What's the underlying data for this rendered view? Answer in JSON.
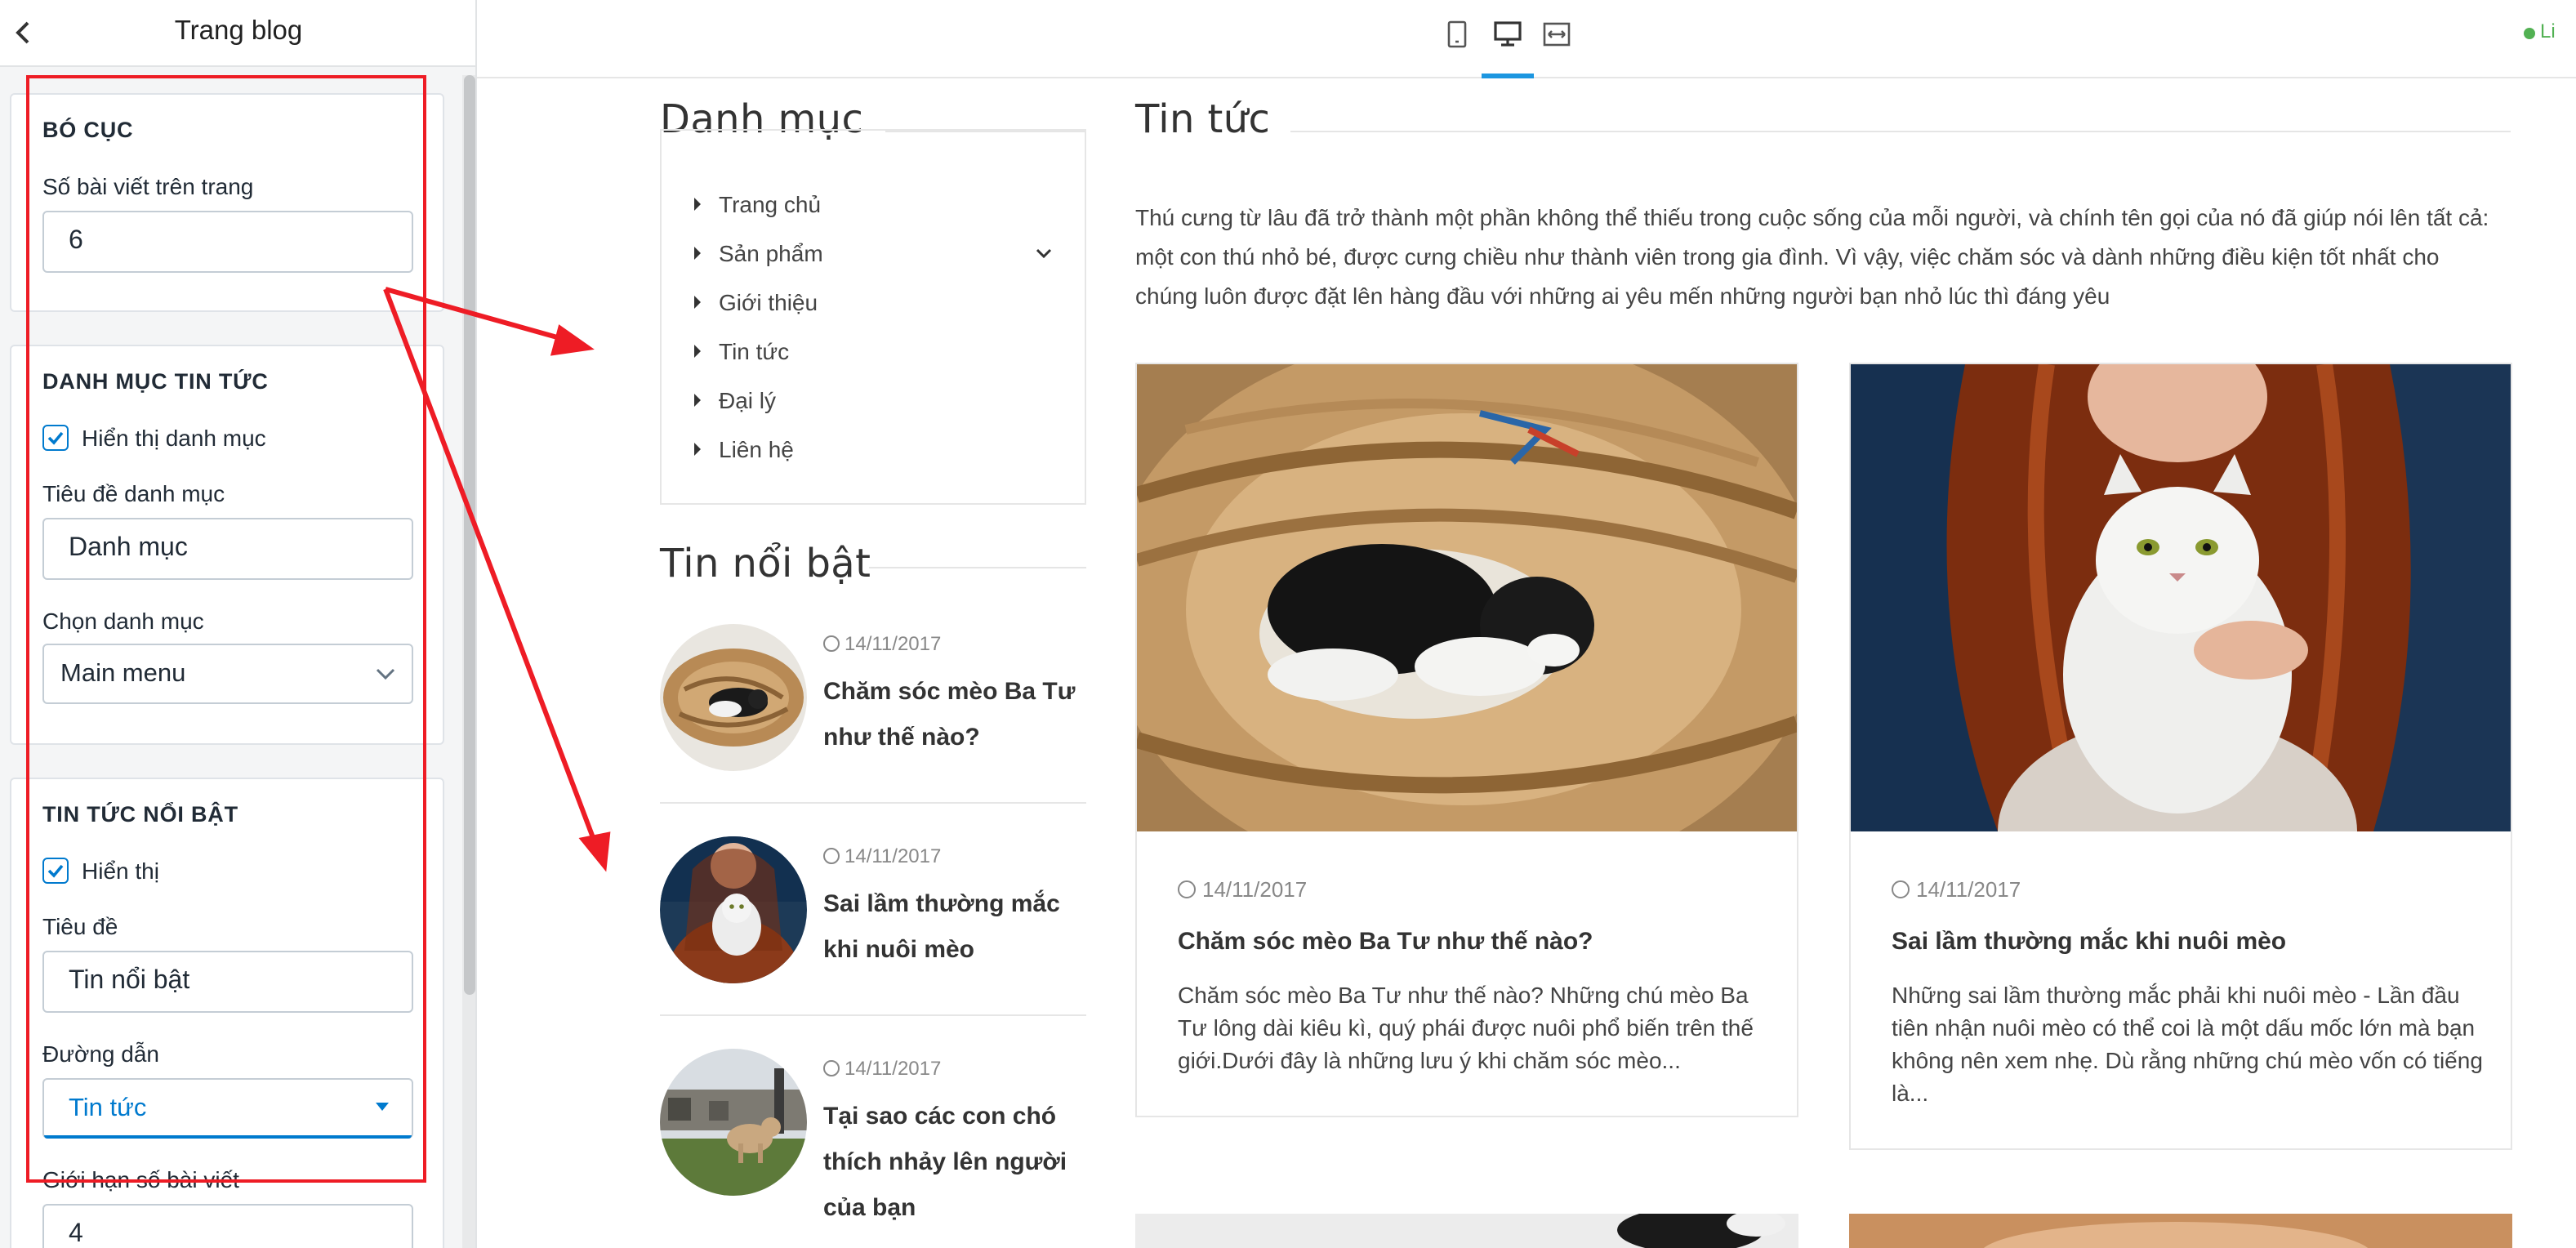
{
  "sidebar": {
    "title": "Trang blog",
    "back_icon": "chevron-left-icon",
    "layout": {
      "heading": "BÓ CỤC",
      "posts_per_page_label": "Số bài viết trên trang",
      "posts_per_page_value": "6"
    },
    "news_category": {
      "heading": "DANH MỤC TIN TỨC",
      "show_label": "Hiển thị danh mục",
      "show_checked": true,
      "title_label": "Tiêu đề danh mục",
      "title_value": "Danh mục",
      "choose_label": "Chọn danh mục",
      "choose_value": "Main menu"
    },
    "featured": {
      "heading": "TIN TỨC NỔI BẬT",
      "show_label": "Hiển thị",
      "show_checked": true,
      "title_label": "Tiêu đề",
      "title_value": "Tin nổi bật",
      "link_label": "Đường dẫn",
      "link_value": "Tin tức",
      "limit_label": "Giới hạn số bài viết",
      "limit_value": "4"
    }
  },
  "topbar": {
    "devices": [
      "mobile-icon",
      "desktop-icon",
      "fullwidth-icon"
    ],
    "active_device": "desktop-icon",
    "live_label": "Li",
    "accent_color": "#1c96e0"
  },
  "preview": {
    "categories": {
      "title": "Danh mục",
      "items": [
        "Trang chủ",
        "Sản phẩm",
        "Giới thiệu",
        "Tin tức",
        "Đại lý",
        "Liên hệ"
      ]
    },
    "featured": {
      "title": "Tin nổi bật",
      "posts": [
        {
          "date": "14/11/2017",
          "title": "Chăm sóc mèo Ba Tư như thế nào?"
        },
        {
          "date": "14/11/2017",
          "title": "Sai lầm thường mắc khi nuôi mèo"
        },
        {
          "date": "14/11/2017",
          "title": "Tại sao các con chó thích nhảy lên người của bạn"
        }
      ]
    },
    "news": {
      "title": "Tin tức",
      "intro": "Thú cưng từ lâu đã trở thành một phần không thể thiếu trong cuộc sống của mỗi người, và chính tên gọi của nó đã giúp nói lên tất cả: một con thú nhỏ bé, được cưng chiều như thành viên trong gia đình. Vì vậy, việc chăm sóc và dành những điều kiện tốt nhất cho chúng luôn được đặt lên hàng đầu với những ai yêu mến những người bạn nhỏ lúc thì đáng yêu",
      "cards": [
        {
          "date": "14/11/2017",
          "title": "Chăm sóc mèo Ba Tư như thế nào?",
          "excerpt": "Chăm sóc mèo Ba Tư như thế nào? Những chú mèo Ba Tư lông dài kiêu kì, quý phái được nuôi phổ biến trên thế giới.Dưới đây là những lưu ý khi chăm sóc mèo..."
        },
        {
          "date": "14/11/2017",
          "title": "Sai lầm thường mắc khi nuôi mèo",
          "excerpt": "Những sai lầm thường mắc phải khi nuôi mèo - Lần đầu tiên nhận nuôi mèo có thể coi là một dấu mốc lớn mà bạn không nên xem nhẹ. Dù rằng những chú mèo vốn có tiếng là..."
        }
      ]
    }
  },
  "annotation_color": "#ee1c25"
}
